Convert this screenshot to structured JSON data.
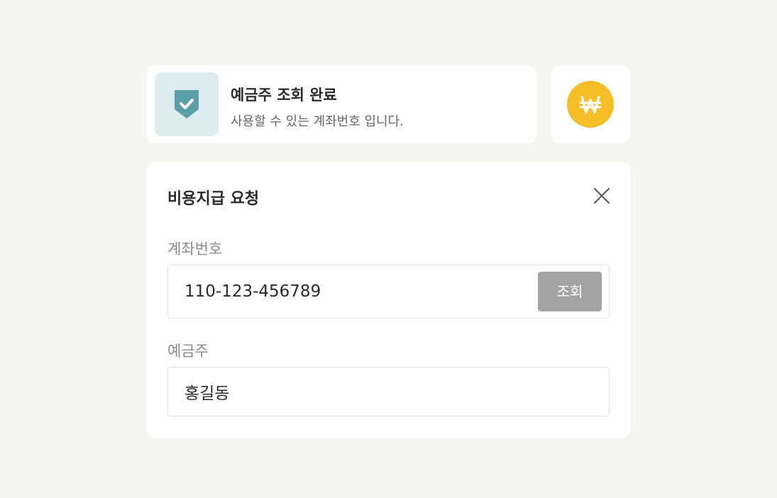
{
  "toast": {
    "icon": "shield-check-icon",
    "title": "예금주 조회 완료",
    "message": "사용할 수 있는 계좌번호 입니다."
  },
  "currency_badge": {
    "icon": "won-icon"
  },
  "dialog": {
    "title": "비용지급 요청",
    "close_icon": "close-icon",
    "account": {
      "label": "계좌번호",
      "value": "110-123-456789",
      "lookup_label": "조회"
    },
    "holder": {
      "label": "예금주",
      "value": "홍길동"
    }
  },
  "colors": {
    "background": "#f5f4ef",
    "shield": "#5a9ea6",
    "shield_bg": "#dcecf0",
    "won_badge": "#f6bd27",
    "lookup_button": "#a4a4a4"
  }
}
